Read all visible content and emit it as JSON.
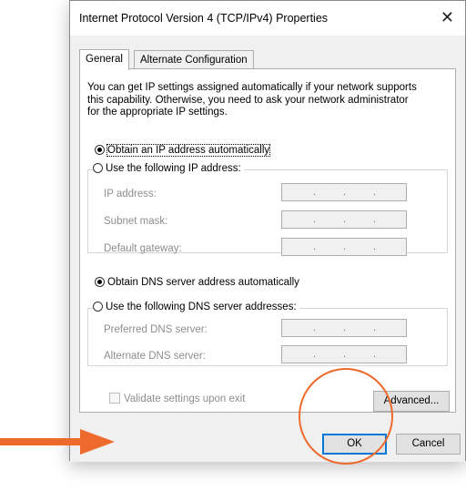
{
  "window": {
    "title": "Internet Protocol Version 4 (TCP/IPv4) Properties",
    "close_glyph": "✕"
  },
  "tabs": [
    {
      "label": "General",
      "active": true
    },
    {
      "label": "Alternate Configuration",
      "active": false
    }
  ],
  "description": "You can get IP settings assigned automatically if your network supports\nthis capability. Otherwise, you need to ask your network administrator\nfor the appropriate IP settings.",
  "ip": {
    "auto_label": "Obtain an IP address automatically",
    "manual_label": "Use the following IP address:",
    "selected": "auto",
    "fields": [
      {
        "label": "IP address:",
        "value": ""
      },
      {
        "label": "Subnet mask:",
        "value": ""
      },
      {
        "label": "Default gateway:",
        "value": ""
      }
    ]
  },
  "dns": {
    "auto_label": "Obtain DNS server address automatically",
    "manual_label": "Use the following DNS server addresses:",
    "selected": "auto",
    "fields": [
      {
        "label": "Preferred DNS server:",
        "value": ""
      },
      {
        "label": "Alternate DNS server:",
        "value": ""
      }
    ]
  },
  "validate": {
    "label": "Validate settings upon exit",
    "checked": false,
    "enabled": false
  },
  "buttons": {
    "advanced": "Advanced...",
    "ok": "OK",
    "cancel": "Cancel"
  },
  "annotation": {
    "color": "#ee6a2c",
    "arrow": "arrow-right-icon",
    "highlight": "ok-button"
  }
}
